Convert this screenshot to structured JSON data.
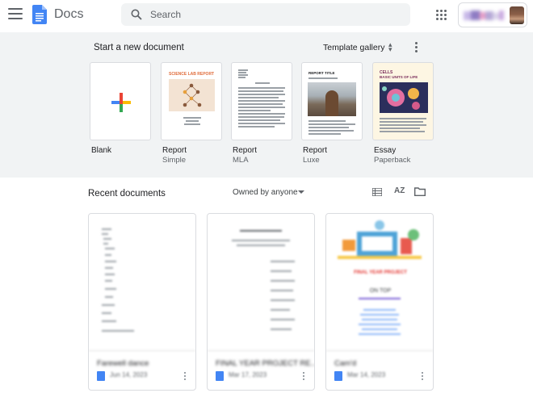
{
  "header": {
    "app_name": "Docs",
    "search_placeholder": "Search"
  },
  "templates": {
    "section_title": "Start a new document",
    "gallery_label": "Template gallery",
    "items": [
      {
        "name": "Blank",
        "sub": ""
      },
      {
        "name": "Report",
        "sub": "Simple",
        "thumb_text": "SCIENCE LAB REPORT"
      },
      {
        "name": "Report",
        "sub": "MLA"
      },
      {
        "name": "Report",
        "sub": "Luxe",
        "thumb_text": "REPORT TITLE"
      },
      {
        "name": "Essay",
        "sub": "Paperback",
        "thumb_text": "CELLS",
        "thumb_text2": "BASIC UNITS OF LIFE"
      }
    ]
  },
  "recent": {
    "title": "Recent documents",
    "owner_filter": "Owned by anyone",
    "sort_label": "AZ",
    "docs": [
      {
        "title": "Farewell dance",
        "meta": "Jun 14, 2023"
      },
      {
        "title": "FINAL YEAR PROJECT RE...",
        "meta": "Mar 17, 2023"
      },
      {
        "title": "Cam'd",
        "meta": "Mar 14, 2023",
        "preview_title": "FINAL YEAR PROJECT",
        "preview_sub": "ON TOP"
      }
    ]
  },
  "colors": {
    "band": "#f1f3f4",
    "docs_blue": "#4285f4",
    "plus_red": "#ea4335",
    "plus_yellow": "#fbbc04",
    "plus_green": "#34a853",
    "plus_blue": "#4285f4"
  }
}
